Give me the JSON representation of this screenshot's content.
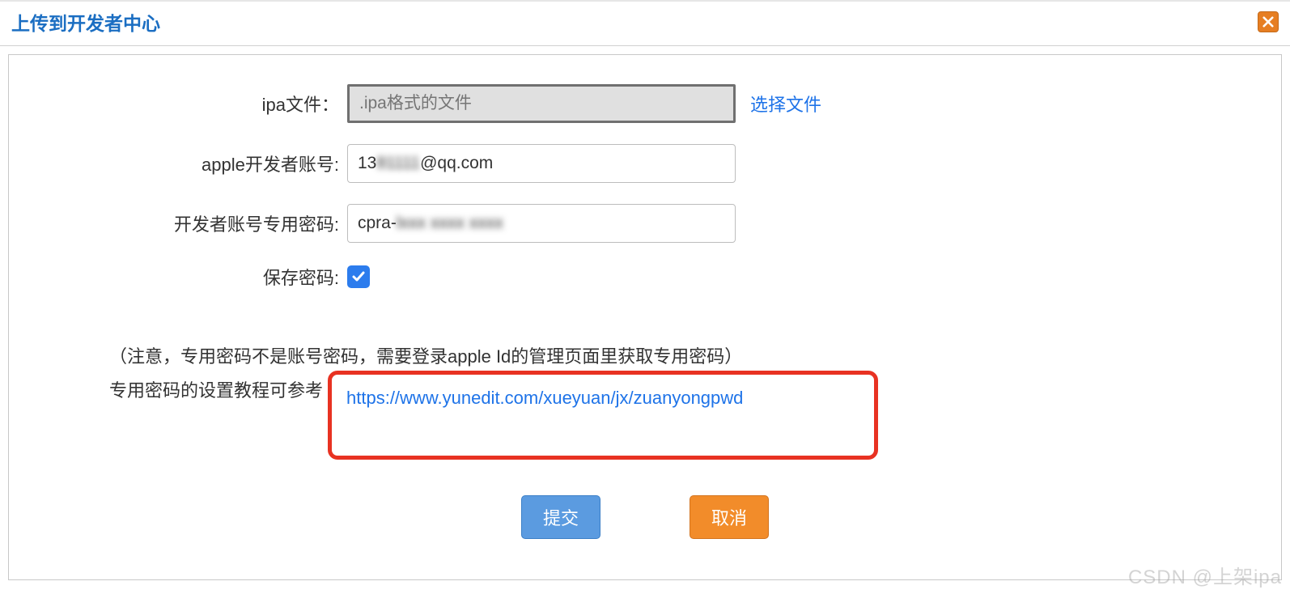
{
  "dialog": {
    "title": "上传到开发者中心",
    "close_icon": "x"
  },
  "form": {
    "ipa": {
      "label": "ipa文件：",
      "placeholder": ".ipa格式的文件",
      "select_button": "选择文件"
    },
    "account": {
      "label": "apple开发者账号:",
      "value_prefix": "13",
      "value_blur": "81111",
      "value_suffix": "@qq.com"
    },
    "password": {
      "label": "开发者账号专用密码:",
      "value_prefix": "cpra-",
      "value_blur": "lxxx xxxx xxxx"
    },
    "save": {
      "label": "保存密码:",
      "checked": true
    }
  },
  "notes": {
    "line1": "（注意，专用密码不是账号密码，需要登录apple Id的管理页面里获取专用密码）",
    "line2_prefix": "专用密码的设置教程可参考",
    "tutorial_url": "https://www.yunedit.com/xueyuan/jx/zuanyongpwd"
  },
  "buttons": {
    "submit": "提交",
    "cancel": "取消"
  },
  "watermark": "CSDN @上架ipa"
}
